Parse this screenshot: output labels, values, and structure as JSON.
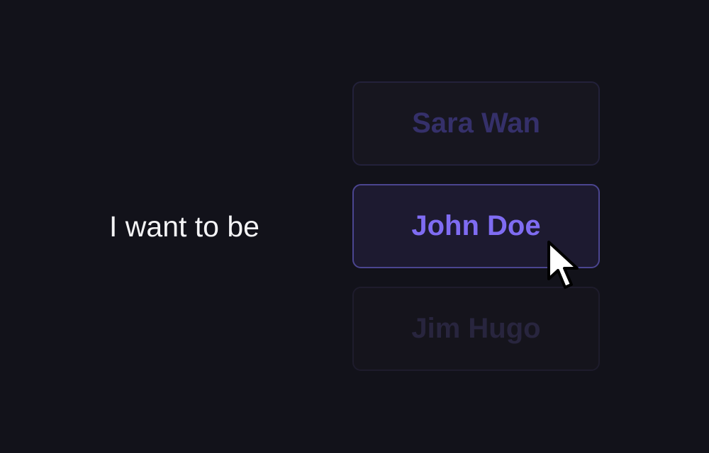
{
  "prompt": "I want to be",
  "options": [
    {
      "label": "Sara Wan",
      "state": "inactive"
    },
    {
      "label": "John Doe",
      "state": "selected"
    },
    {
      "label": "Jim Hugo",
      "state": "inactive"
    }
  ],
  "colors": {
    "background": "#12121a",
    "prompt_text": "#f4f4f6",
    "selected_text": "#7f6cf2",
    "selected_border": "#4b4590",
    "inactive_text": "#35306a"
  },
  "cursor": "arrow-pointer-icon"
}
